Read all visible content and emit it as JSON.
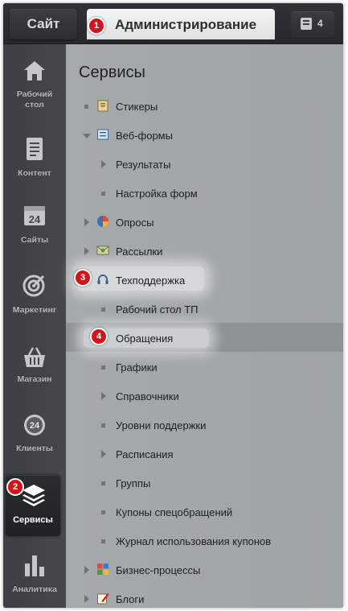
{
  "topbar": {
    "site_tab": "Сайт",
    "admin_tab": "Администрирование",
    "notification_count": "4"
  },
  "badges": [
    "1",
    "2",
    "3",
    "4"
  ],
  "sidebar": {
    "items": [
      {
        "label": "Рабочий\nстол",
        "icon": "home-icon"
      },
      {
        "label": "Контент",
        "icon": "document-icon"
      },
      {
        "label": "Сайты",
        "icon": "calendar-24-icon"
      },
      {
        "label": "Маркетинг",
        "icon": "target-icon"
      },
      {
        "label": "Магазин",
        "icon": "basket-icon"
      },
      {
        "label": "Клиенты",
        "icon": "clients-24-icon"
      },
      {
        "label": "Сервисы",
        "icon": "layers-icon",
        "active": true
      },
      {
        "label": "Аналитика",
        "icon": "bar-chart-icon"
      }
    ]
  },
  "main": {
    "title": "Сервисы",
    "items": [
      {
        "label": "Стикеры",
        "level": 0,
        "marker": "bullet",
        "icon": "sticker-icon"
      },
      {
        "label": "Веб-формы",
        "level": 0,
        "marker": "expanded",
        "icon": "webform-icon"
      },
      {
        "label": "Результаты",
        "level": 1,
        "marker": "collapsed"
      },
      {
        "label": "Настройка форм",
        "level": 1,
        "marker": "bullet"
      },
      {
        "label": "Опросы",
        "level": 0,
        "marker": "collapsed",
        "icon": "pie-icon"
      },
      {
        "label": "Рассылки",
        "level": 0,
        "marker": "collapsed",
        "icon": "envelope-icon"
      },
      {
        "label": "Техподдержка",
        "level": 0,
        "marker": "expanded",
        "icon": "headset-icon",
        "highlighted": true
      },
      {
        "label": "Рабочий стол ТП",
        "level": 1,
        "marker": "bullet"
      },
      {
        "label": "Обращения",
        "level": 1,
        "marker": "bullet",
        "selected": true,
        "highlighted": true
      },
      {
        "label": "Графики",
        "level": 1,
        "marker": "bullet"
      },
      {
        "label": "Справочники",
        "level": 1,
        "marker": "collapsed"
      },
      {
        "label": "Уровни поддержки",
        "level": 1,
        "marker": "bullet"
      },
      {
        "label": "Расписания",
        "level": 1,
        "marker": "collapsed"
      },
      {
        "label": "Группы",
        "level": 1,
        "marker": "bullet"
      },
      {
        "label": "Купоны спецобращений",
        "level": 1,
        "marker": "bullet"
      },
      {
        "label": "Журнал использования купонов",
        "level": 1,
        "marker": "bullet"
      },
      {
        "label": "Бизнес-процессы",
        "level": 0,
        "marker": "collapsed",
        "icon": "puzzle-icon"
      },
      {
        "label": "Блоги",
        "level": 0,
        "marker": "collapsed",
        "icon": "blog-pencil-icon"
      }
    ]
  },
  "colors": {
    "badge": "#d0161c",
    "sidebar": "#3c3f44",
    "content": "#a2a7a8",
    "selected_row": "#8d9394"
  }
}
